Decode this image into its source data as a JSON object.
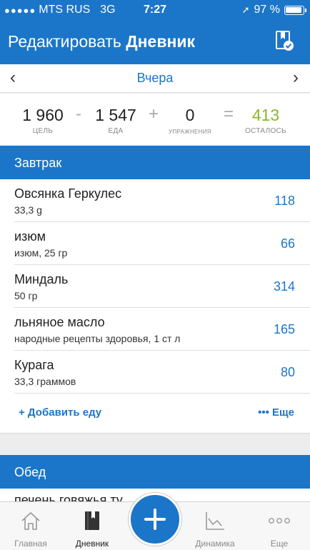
{
  "status_bar": {
    "carrier": "MTS RUS",
    "network": "3G",
    "time": "7:27",
    "battery": "97 %"
  },
  "nav": {
    "title_regular": "Редактировать",
    "title_bold": "Дневник",
    "right_icon": "diary-check-icon"
  },
  "date": {
    "label": "Вчера",
    "prev_icon": "chevron-left-icon",
    "next_icon": "chevron-right-icon"
  },
  "summary": {
    "goal": {
      "value": "1 960",
      "label": "ЦЕЛЬ"
    },
    "minus": "-",
    "food": {
      "value": "1 547",
      "label": "ЕДА"
    },
    "plus": "+",
    "exercise": {
      "value": "0",
      "label": "УПРАЖНЕНИЯ"
    },
    "equals": "=",
    "remaining": {
      "value": "413",
      "label": "ОСТАЛОСЬ"
    }
  },
  "breakfast": {
    "title": "Завтрак",
    "items": [
      {
        "name": "Овсянка Геркулес",
        "detail": "33,3 g",
        "calories": "118"
      },
      {
        "name": "изюм",
        "detail": "изюм, 25 гр",
        "calories": "66"
      },
      {
        "name": "Миндаль",
        "detail": "50 гр",
        "calories": "314"
      },
      {
        "name": "льняное масло",
        "detail": "народные рецепты здоровья, 1 ст л",
        "calories": "165"
      },
      {
        "name": "Курага",
        "detail": "33,3 граммов",
        "calories": "80"
      }
    ],
    "add_food": "+ Добавить еду",
    "more": "••• Еще"
  },
  "lunch": {
    "title": "Обед",
    "peek_item": "печень говяжья ту"
  },
  "tab_bar": {
    "tabs": [
      {
        "label": "Главная",
        "icon": "home-icon"
      },
      {
        "label": "Дневник",
        "icon": "diary-book-icon"
      },
      {
        "label": "Динамика",
        "icon": "chart-icon"
      },
      {
        "label": "Еще",
        "icon": "more-dots-icon"
      }
    ],
    "fab_icon": "plus-icon"
  },
  "colors": {
    "accent": "#1b76c9",
    "remaining": "#8bb82a"
  }
}
